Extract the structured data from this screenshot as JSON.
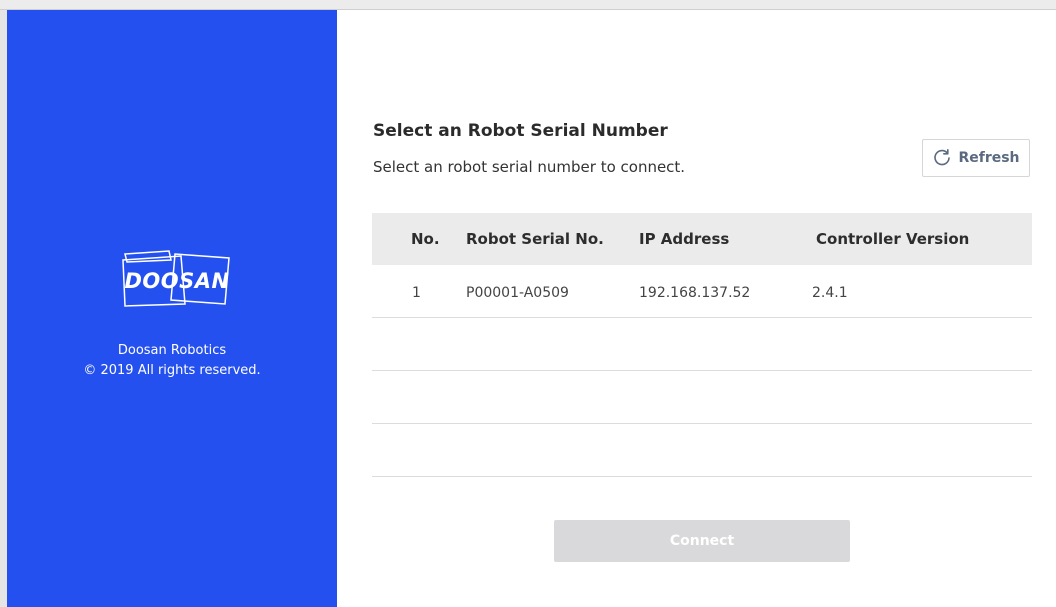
{
  "sidebar": {
    "logo_text": "DOOSAN",
    "company": "Doosan Robotics",
    "copyright": "© 2019 All rights reserved.",
    "background_color": "#2450f0"
  },
  "main": {
    "title": "Select an Robot Serial Number",
    "subtitle": "Select an robot serial number to connect.",
    "refresh": {
      "label": "Refresh",
      "icon": "refresh-icon"
    },
    "table": {
      "columns": [
        "No.",
        "Robot Serial No.",
        "IP Address",
        "Controller Version"
      ],
      "rows": [
        {
          "no": "1",
          "serial": "P00001-A0509",
          "ip": "192.168.137.52",
          "version": "2.4.1"
        },
        {
          "no": "",
          "serial": "",
          "ip": "",
          "version": ""
        },
        {
          "no": "",
          "serial": "",
          "ip": "",
          "version": ""
        },
        {
          "no": "",
          "serial": "",
          "ip": "",
          "version": ""
        }
      ]
    },
    "connect": {
      "label": "Connect",
      "disabled": true
    }
  }
}
